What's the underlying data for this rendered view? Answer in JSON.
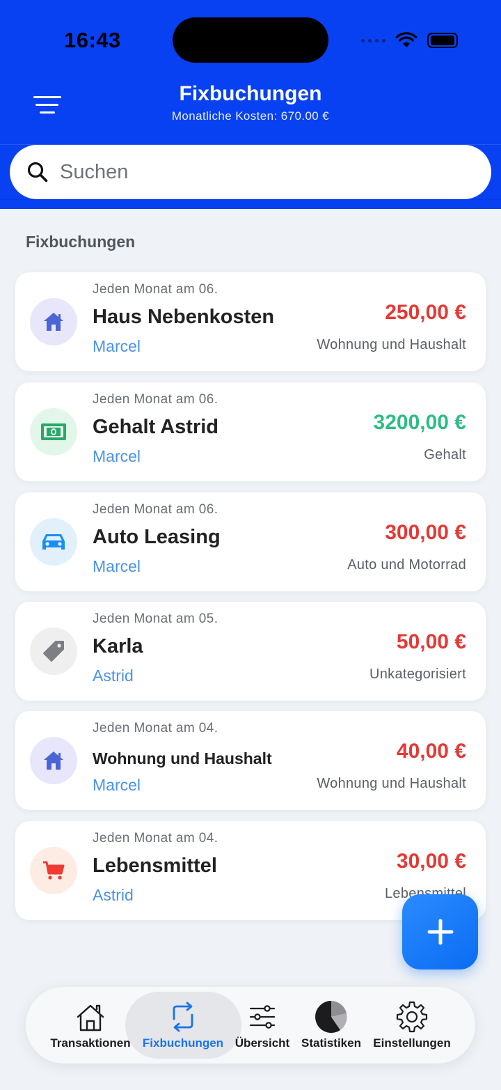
{
  "status_bar": {
    "time": "16:43"
  },
  "header": {
    "title": "Fixbuchungen",
    "subtitle": "Monatliche Kosten: 670.00 €"
  },
  "search": {
    "placeholder": "Suchen",
    "value": ""
  },
  "section": {
    "title": "Fixbuchungen"
  },
  "items": [
    {
      "frequency": "Jeden Monat am 06.",
      "name": "Haus Nebenkosten",
      "person": "Marcel",
      "amount": "250,00 €",
      "category": "Wohnung und Haushalt",
      "icon": "house-icon",
      "amount_color": "#e53935",
      "icon_bg": "#e8e6fb"
    },
    {
      "frequency": "Jeden Monat am 06.",
      "name": "Gehalt Astrid",
      "person": "Marcel",
      "amount": "3200,00 €",
      "category": "Gehalt",
      "icon": "money-icon",
      "amount_color": "#2ebd85",
      "icon_bg": "#e3f6ea"
    },
    {
      "frequency": "Jeden Monat am 06.",
      "name": "Auto Leasing",
      "person": "Marcel",
      "amount": "300,00 €",
      "category": "Auto und Motorrad",
      "icon": "car-icon",
      "amount_color": "#e53935",
      "icon_bg": "#e2f0fc"
    },
    {
      "frequency": "Jeden Monat am 05.",
      "name": "Karla",
      "person": "Astrid",
      "amount": "50,00 €",
      "category": "Unkategorisiert",
      "icon": "tag-icon",
      "amount_color": "#e53935",
      "icon_bg": "#efefef"
    },
    {
      "frequency": "Jeden Monat am 04.",
      "name": "Wohnung und Haushalt",
      "person": "Marcel",
      "amount": "40,00 €",
      "category": "Wohnung und Haushalt",
      "icon": "house-icon",
      "amount_color": "#e53935",
      "icon_bg": "#e8e6fb"
    },
    {
      "frequency": "Jeden Monat am 04.",
      "name": "Lebensmittel",
      "person": "Astrid",
      "amount": "30,00 €",
      "category": "Lebensmittel",
      "icon": "cart-icon",
      "amount_color": "#e53935",
      "icon_bg": "#fdece3"
    }
  ],
  "tabs": [
    {
      "label": "Transaktionen",
      "icon": "home-outline-icon",
      "active": false
    },
    {
      "label": "Fixbuchungen",
      "icon": "repeat-icon",
      "active": true
    },
    {
      "label": "Übersicht",
      "icon": "sliders-icon",
      "active": false
    },
    {
      "label": "Statistiken",
      "icon": "pie-chart-icon",
      "active": false
    },
    {
      "label": "Einstellungen",
      "icon": "gear-icon",
      "active": false
    }
  ],
  "colors": {
    "header_bg": "#0741f2",
    "accent": "#1a73e8",
    "person_text": "#4a92e6",
    "expense": "#e53935",
    "income": "#2ebd85"
  }
}
